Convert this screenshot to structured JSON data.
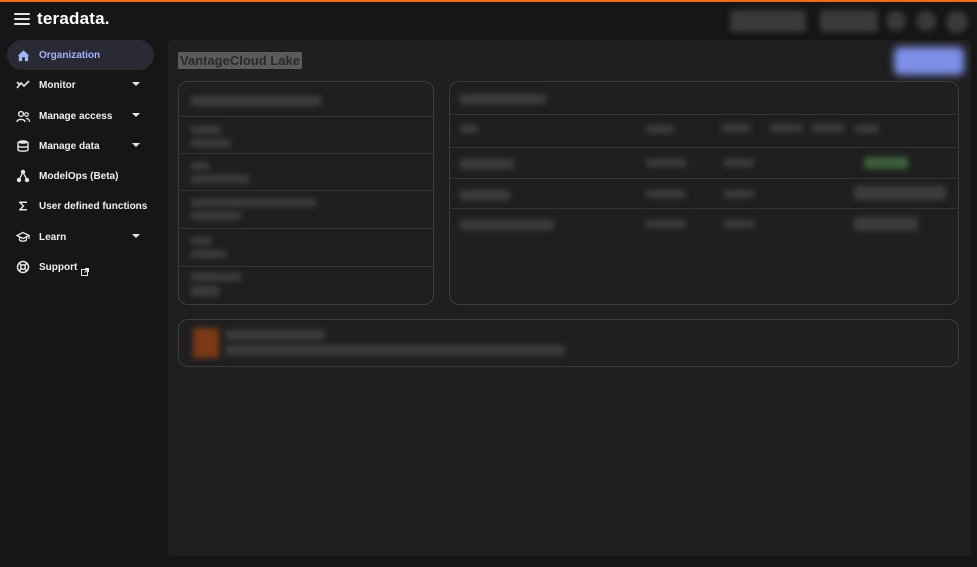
{
  "app": {
    "brand": "teradata."
  },
  "sidebar": {
    "items": [
      {
        "label": "Organization",
        "icon": "home-icon",
        "active": true,
        "expandable": false
      },
      {
        "label": "Monitor",
        "icon": "trend-icon",
        "active": false,
        "expandable": true
      },
      {
        "label": "Manage access",
        "icon": "users-icon",
        "active": false,
        "expandable": true
      },
      {
        "label": "Manage data",
        "icon": "database-icon",
        "active": false,
        "expandable": true
      },
      {
        "label": "ModelOps (Beta)",
        "icon": "network-icon",
        "active": false,
        "expandable": false
      },
      {
        "label": "User defined functions",
        "icon": "sigma-icon",
        "active": false,
        "expandable": false
      },
      {
        "label": "Learn",
        "icon": "graduation-cap-icon",
        "active": false,
        "expandable": true
      },
      {
        "label": "Support",
        "icon": "lifebuoy-icon",
        "active": false,
        "expandable": false,
        "external": true
      }
    ]
  },
  "main": {
    "page_title": "VantageCloud Lake"
  },
  "colors": {
    "accent_top": "#ec6a1c",
    "active_nav_bg": "#2a2a34",
    "active_nav_text": "#a3b3ff",
    "primary_button": "#7d8fe8",
    "main_bg": "#1f1f1f",
    "app_bg": "#161616"
  }
}
